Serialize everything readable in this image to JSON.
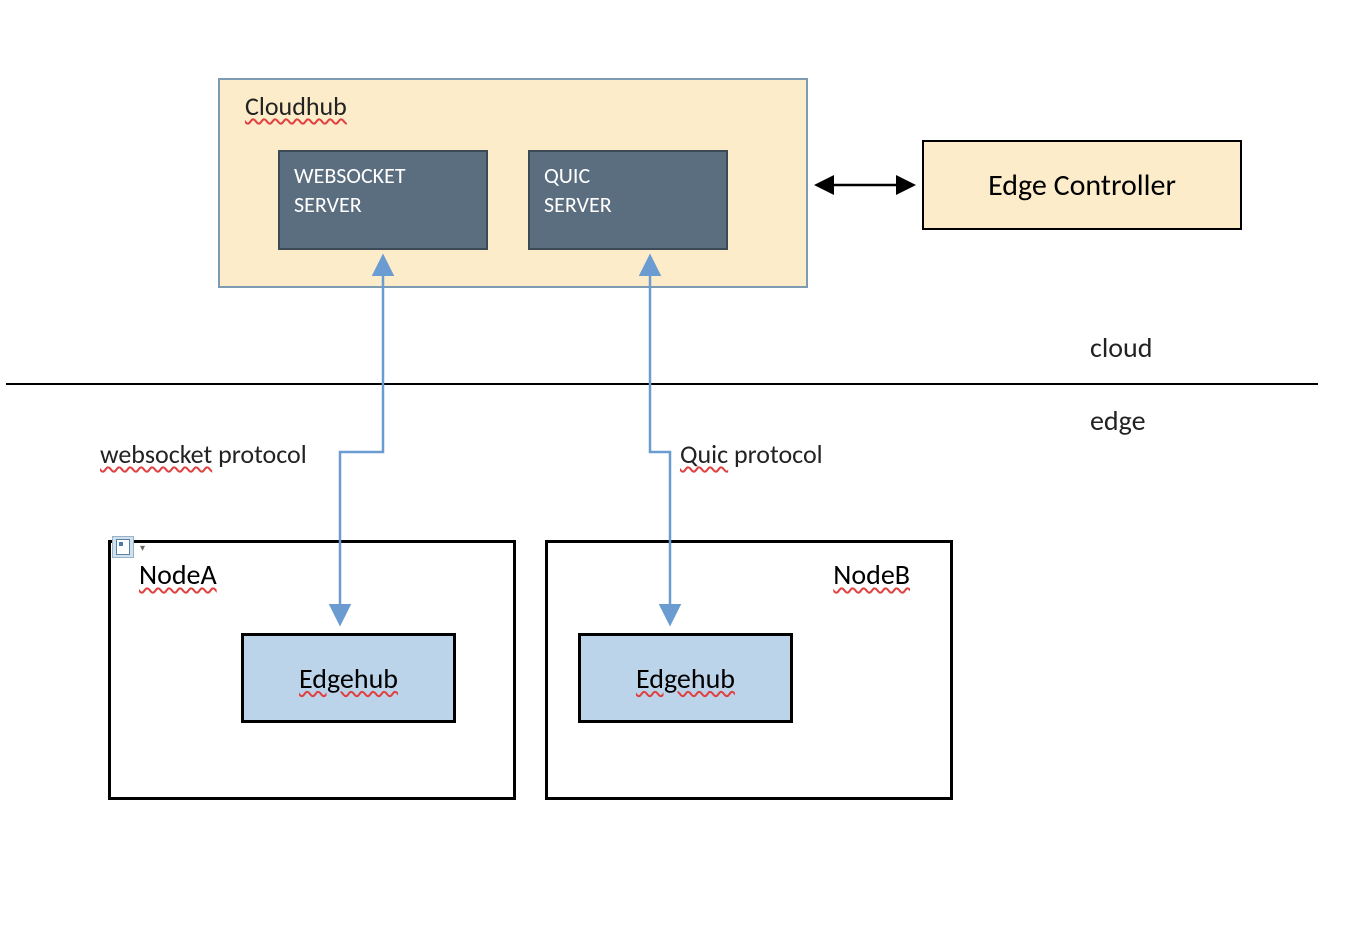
{
  "cloudhub": {
    "title": "Cloudhub",
    "websocket_server": {
      "line1": "WEBSOCKET",
      "line2": "SERVER"
    },
    "quic_server": {
      "line1": "QUIC",
      "line2": "SERVER"
    }
  },
  "edge_controller": {
    "label": "Edge Controller"
  },
  "zones": {
    "cloud": "cloud",
    "edge": "edge"
  },
  "protocols": {
    "websocket_word": "websocket",
    "websocket_rest": " protocol",
    "quic_word": "Quic",
    "quic_rest": " protocol"
  },
  "nodes": {
    "node_a": {
      "title": "NodeA",
      "edgehub": "Edgehub"
    },
    "node_b": {
      "title": "NodeB",
      "edgehub": "Edgehub"
    }
  }
}
